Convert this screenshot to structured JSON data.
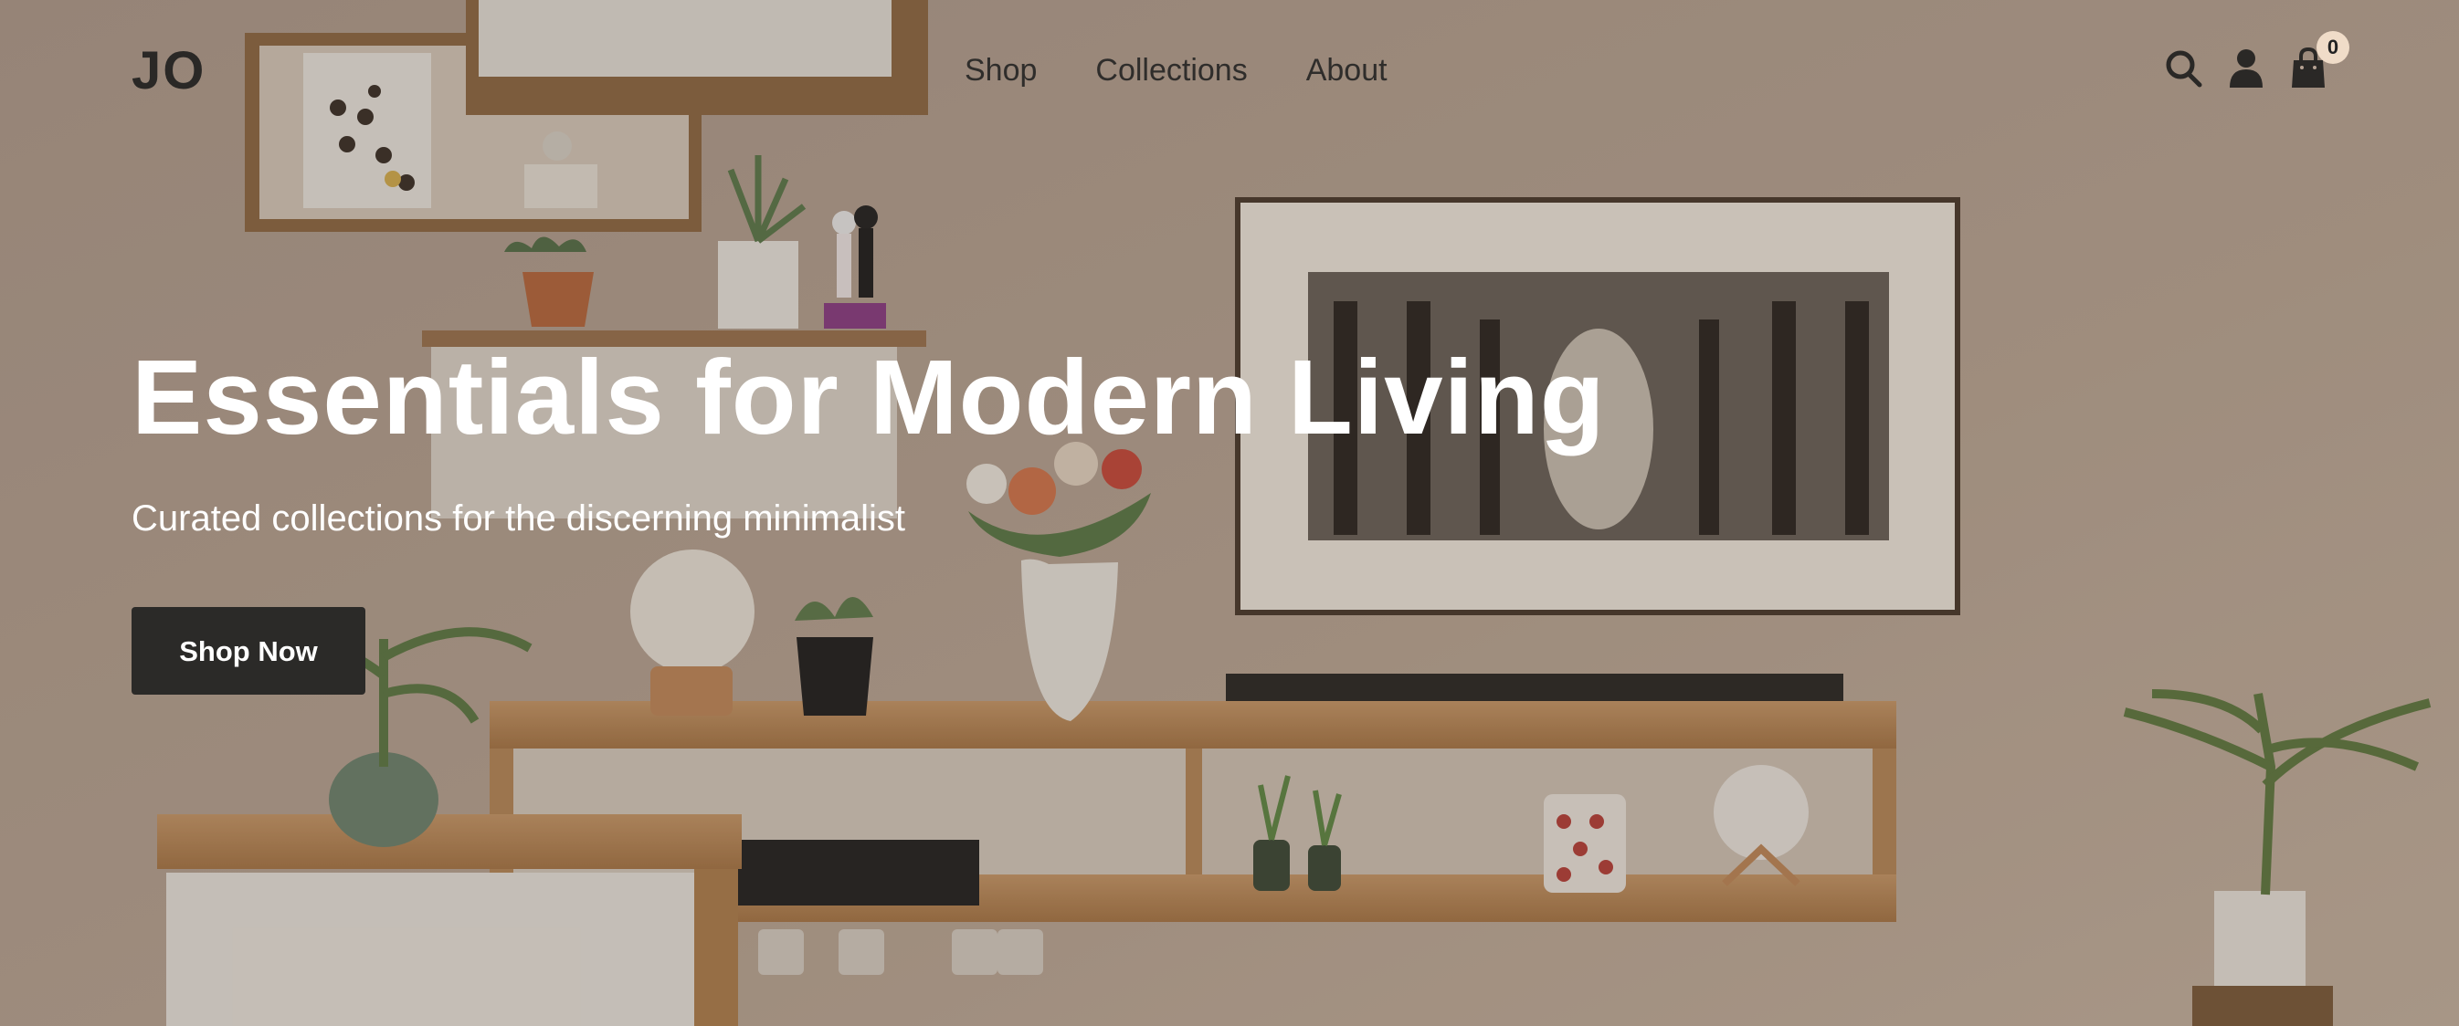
{
  "header": {
    "logo": "JO",
    "nav": [
      {
        "label": "Shop"
      },
      {
        "label": "Collections"
      },
      {
        "label": "About"
      }
    ],
    "cart_count": "0",
    "icons": [
      "search-icon",
      "account-icon",
      "shopping-bag-icon"
    ]
  },
  "hero": {
    "title": "Essentials for Modern Living",
    "subtitle": "Curated collections for the discerning minimalist",
    "cta_label": "Shop Now"
  },
  "colors": {
    "text_dark": "#2a2826",
    "button_bg": "#2b2a28",
    "badge_bg": "#f0dcc8",
    "hero_text": "#ffffff"
  }
}
